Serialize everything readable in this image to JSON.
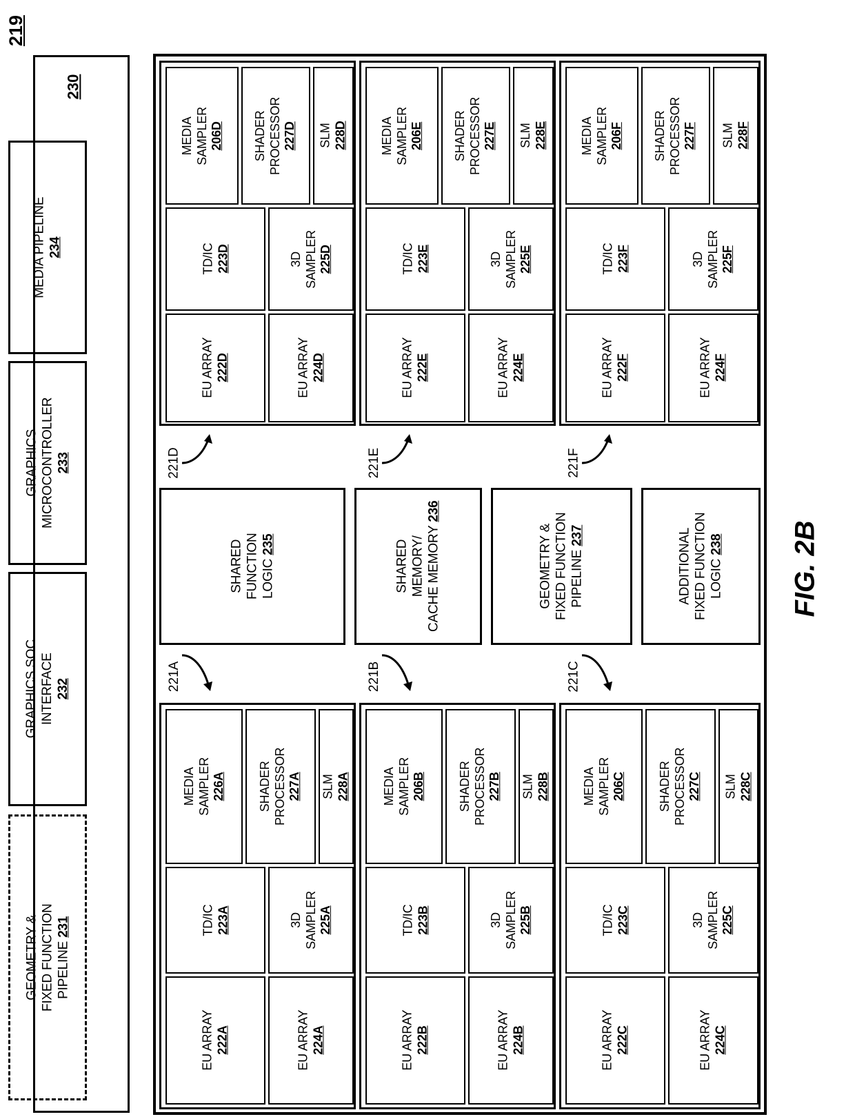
{
  "figure": {
    "sheet_ref": "219",
    "caption": "FIG. 2B"
  },
  "common_logic": {
    "id": "230",
    "boxes": [
      {
        "name": "geometry-fixed-function-pipeline-231",
        "line1": "GEOMETRY &",
        "line2": "FIXED FUNCTION",
        "line3": "PIPELINE",
        "num": "231",
        "dashed": true
      },
      {
        "name": "graphics-soc-interface-232",
        "line1": "GRAPHICS SOC",
        "line2": "INTERFACE",
        "line3": "",
        "num": "232",
        "dashed": false
      },
      {
        "name": "graphics-microcontroller-233",
        "line1": "GRAPHICS",
        "line2": "MICROCONTROLLER",
        "line3": "",
        "num": "233",
        "dashed": false
      },
      {
        "name": "media-pipeline-234",
        "line1": "MEDIA PIPELINE",
        "line2": "",
        "line3": "",
        "num": "234",
        "dashed": false
      }
    ]
  },
  "shared": [
    {
      "name": "shared-function-logic-235",
      "line1": "SHARED",
      "line2": "FUNCTION",
      "line3": "LOGIC",
      "num": "235"
    },
    {
      "name": "shared-memory-cache-memory-236",
      "line1": "SHARED",
      "line2": "MEMORY/",
      "line3": "CACHE MEMORY",
      "num": "236"
    },
    {
      "name": "geometry-fixed-function-pipeline-237",
      "line1": "GEOMETRY &",
      "line2": "FIXED FUNCTION",
      "line3": "PIPELINE",
      "num": "237"
    },
    {
      "name": "additional-fixed-function-logic-238",
      "line1": "ADDITIONAL",
      "line2": "FIXED FUNCTION",
      "line3": "LOGIC",
      "num": "238"
    }
  ],
  "subslices": [
    {
      "ref": "221D",
      "cells": {
        "media_sampler": {
          "line1": "MEDIA",
          "line2": "SAMPLER",
          "num": "206D"
        },
        "shader_processor": {
          "line1": "SHADER",
          "line2": "PROCESSOR",
          "num": "227D"
        },
        "slm": {
          "line1": "SLM",
          "line2": "",
          "num": "228D"
        },
        "tdic": {
          "line1": "TD/IC",
          "line2": "",
          "num": "223D"
        },
        "sampler3d": {
          "line1": "3D",
          "line2": "SAMPLER",
          "num": "225D"
        },
        "eu_array_top": {
          "line1": "EU ARRAY",
          "line2": "",
          "num": "222D"
        },
        "eu_array_bottom": {
          "line1": "EU ARRAY",
          "line2": "",
          "num": "224D"
        }
      }
    },
    {
      "ref": "221E",
      "cells": {
        "media_sampler": {
          "line1": "MEDIA",
          "line2": "SAMPLER",
          "num": "206E"
        },
        "shader_processor": {
          "line1": "SHADER",
          "line2": "PROCESSOR",
          "num": "227E"
        },
        "slm": {
          "line1": "SLM",
          "line2": "",
          "num": "228E"
        },
        "tdic": {
          "line1": "TD/IC",
          "line2": "",
          "num": "223E"
        },
        "sampler3d": {
          "line1": "3D",
          "line2": "SAMPLER",
          "num": "225E"
        },
        "eu_array_top": {
          "line1": "EU ARRAY",
          "line2": "",
          "num": "222E"
        },
        "eu_array_bottom": {
          "line1": "EU ARRAY",
          "line2": "",
          "num": "224E"
        }
      }
    },
    {
      "ref": "221F",
      "cells": {
        "media_sampler": {
          "line1": "MEDIA",
          "line2": "SAMPLER",
          "num": "206F"
        },
        "shader_processor": {
          "line1": "SHADER",
          "line2": "PROCESSOR",
          "num": "227F"
        },
        "slm": {
          "line1": "SLM",
          "line2": "",
          "num": "228F"
        },
        "tdic": {
          "line1": "TD/IC",
          "line2": "",
          "num": "223F"
        },
        "sampler3d": {
          "line1": "3D",
          "line2": "SAMPLER",
          "num": "225F"
        },
        "eu_array_top": {
          "line1": "EU ARRAY",
          "line2": "",
          "num": "222F"
        },
        "eu_array_bottom": {
          "line1": "EU ARRAY",
          "line2": "",
          "num": "224F"
        }
      }
    },
    {
      "ref": "221A",
      "cells": {
        "media_sampler": {
          "line1": "MEDIA",
          "line2": "SAMPLER",
          "num": "226A"
        },
        "shader_processor": {
          "line1": "SHADER",
          "line2": "PROCESSOR",
          "num": "227A"
        },
        "slm": {
          "line1": "SLM",
          "line2": "",
          "num": "228A"
        },
        "tdic": {
          "line1": "TD/IC",
          "line2": "",
          "num": "223A"
        },
        "sampler3d": {
          "line1": "3D",
          "line2": "SAMPLER",
          "num": "225A"
        },
        "eu_array_top": {
          "line1": "EU ARRAY",
          "line2": "",
          "num": "222A"
        },
        "eu_array_bottom": {
          "line1": "EU ARRAY",
          "line2": "",
          "num": "224A"
        }
      }
    },
    {
      "ref": "221B",
      "cells": {
        "media_sampler": {
          "line1": "MEDIA",
          "line2": "SAMPLER",
          "num": "206B"
        },
        "shader_processor": {
          "line1": "SHADER",
          "line2": "PROCESSOR",
          "num": "227B"
        },
        "slm": {
          "line1": "SLM",
          "line2": "",
          "num": "228B"
        },
        "tdic": {
          "line1": "TD/IC",
          "line2": "",
          "num": "223B"
        },
        "sampler3d": {
          "line1": "3D",
          "line2": "SAMPLER",
          "num": "225B"
        },
        "eu_array_top": {
          "line1": "EU ARRAY",
          "line2": "",
          "num": "222B"
        },
        "eu_array_bottom": {
          "line1": "EU ARRAY",
          "line2": "",
          "num": "224B"
        }
      }
    },
    {
      "ref": "221C",
      "cells": {
        "media_sampler": {
          "line1": "MEDIA",
          "line2": "SAMPLER",
          "num": "206C"
        },
        "shader_processor": {
          "line1": "SHADER",
          "line2": "PROCESSOR",
          "num": "227C"
        },
        "slm": {
          "line1": "SLM",
          "line2": "",
          "num": "228C"
        },
        "tdic": {
          "line1": "TD/IC",
          "line2": "",
          "num": "223C"
        },
        "sampler3d": {
          "line1": "3D",
          "line2": "SAMPLER",
          "num": "225C"
        },
        "eu_array_top": {
          "line1": "EU ARRAY",
          "line2": "",
          "num": "222C"
        },
        "eu_array_bottom": {
          "line1": "EU ARRAY",
          "line2": "",
          "num": "224C"
        }
      }
    }
  ],
  "colors": {
    "line": "#000000",
    "background": "#ffffff"
  }
}
